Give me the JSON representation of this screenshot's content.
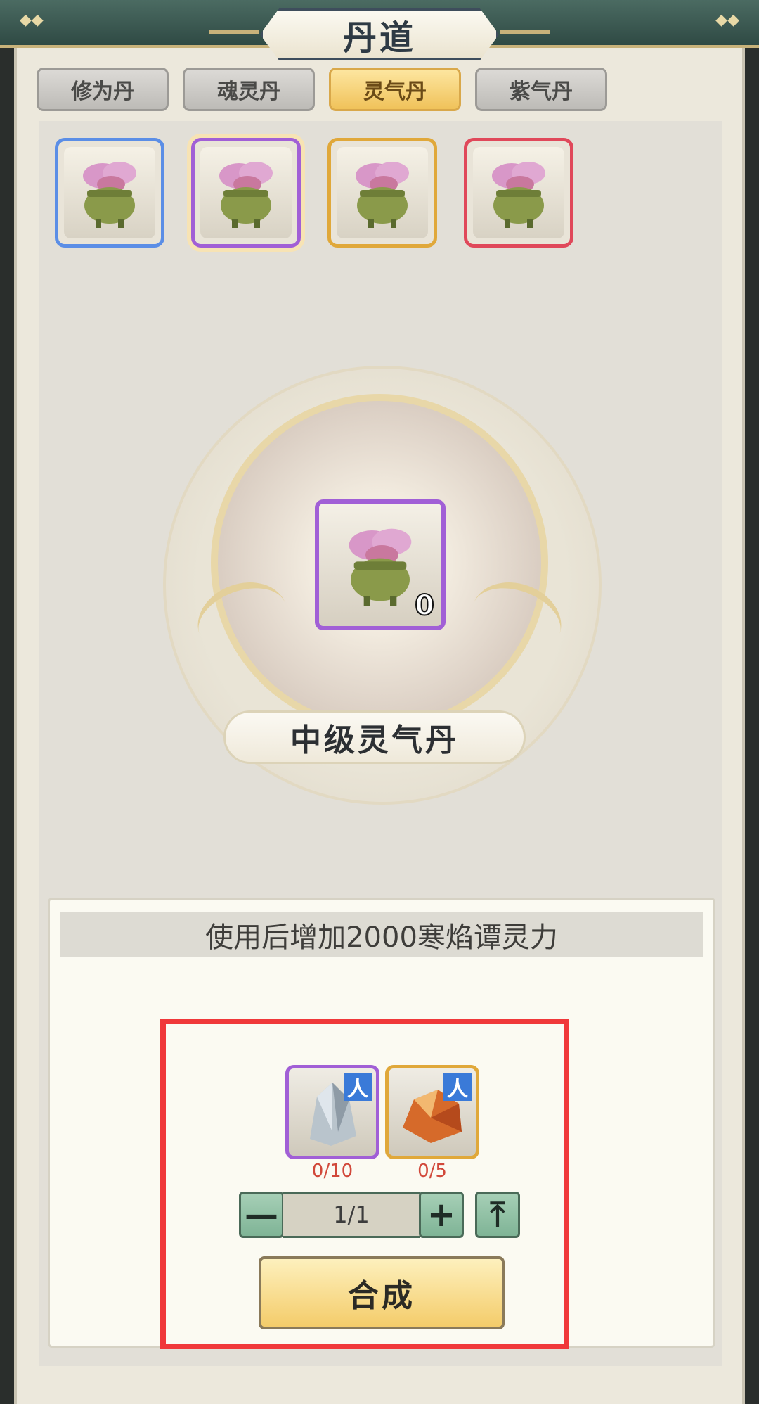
{
  "window": {
    "title": "丹道"
  },
  "tabs": [
    {
      "label": "修为丹",
      "active": false
    },
    {
      "label": "魂灵丹",
      "active": false
    },
    {
      "label": "灵气丹",
      "active": true
    },
    {
      "label": "紫气丹",
      "active": false
    }
  ],
  "pills": [
    {
      "icon": "cauldron-lingzhi-icon",
      "rarity_color": "#5b8ee6",
      "selected": false
    },
    {
      "icon": "cauldron-lingzhi-icon",
      "rarity_color": "#a15fd6",
      "selected": true
    },
    {
      "icon": "cauldron-lingzhi-icon",
      "rarity_color": "#e0a83a",
      "selected": false
    },
    {
      "icon": "cauldron-lingzhi-icon",
      "rarity_color": "#e0485a",
      "selected": false
    }
  ],
  "selected_item": {
    "name": "中级灵气丹",
    "count": "0",
    "description": "使用后增加2000寒焰谭灵力"
  },
  "materials": [
    {
      "icon": "crystal-ore-icon",
      "tag": "人",
      "count": "0/10",
      "rarity_color": "#a15fd6"
    },
    {
      "icon": "amber-ore-icon",
      "tag": "人",
      "count": "0/5",
      "rarity_color": "#e0a83a"
    }
  ],
  "stepper": {
    "minus": "—",
    "plus": "+",
    "max": "⤒",
    "value": "1/1"
  },
  "craft": {
    "label": "合成"
  },
  "colors": {
    "highlight": "#f0383a",
    "active_tab": "#f0c25a"
  }
}
